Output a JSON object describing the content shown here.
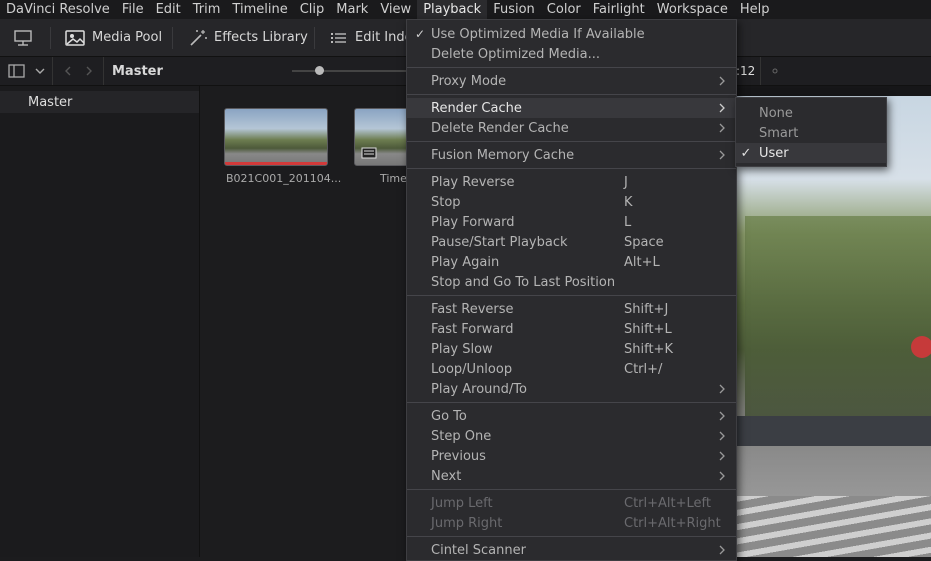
{
  "menubar": {
    "items": [
      "DaVinci Resolve",
      "File",
      "Edit",
      "Trim",
      "Timeline",
      "Clip",
      "Mark",
      "View",
      "Playback",
      "Fusion",
      "Color",
      "Fairlight",
      "Workspace",
      "Help"
    ],
    "active_index": 8
  },
  "toolbar": {
    "media_pool": "Media Pool",
    "effects_library": "Effects Library",
    "edit_index": "Edit Inde"
  },
  "subbar": {
    "bin_title": "Master",
    "timecode_fragment": ":12"
  },
  "sidebar": {
    "items": [
      {
        "label": "Master"
      }
    ]
  },
  "media_pool": {
    "clips": [
      {
        "label": "B021C001_201104..."
      },
      {
        "label": "Time"
      }
    ]
  },
  "playback_menu": {
    "items": [
      {
        "label": "Use Optimized Media If Available",
        "shortcut": "",
        "checked": true,
        "submenu": false,
        "disabled": false
      },
      {
        "label": "Delete Optimized Media...",
        "shortcut": "",
        "checked": false,
        "submenu": false,
        "disabled": false
      },
      {
        "label": "Proxy Mode",
        "shortcut": "",
        "checked": false,
        "submenu": true,
        "disabled": false
      },
      {
        "label": "Render Cache",
        "shortcut": "",
        "checked": false,
        "submenu": true,
        "disabled": false,
        "highlighted": true
      },
      {
        "label": "Delete Render Cache",
        "shortcut": "",
        "checked": false,
        "submenu": true,
        "disabled": false
      },
      {
        "label": "Fusion Memory Cache",
        "shortcut": "",
        "checked": false,
        "submenu": true,
        "disabled": false
      },
      {
        "label": "Play Reverse",
        "shortcut": "J",
        "checked": false,
        "submenu": false,
        "disabled": false
      },
      {
        "label": "Stop",
        "shortcut": "K",
        "checked": false,
        "submenu": false,
        "disabled": false
      },
      {
        "label": "Play Forward",
        "shortcut": "L",
        "checked": false,
        "submenu": false,
        "disabled": false
      },
      {
        "label": "Pause/Start Playback",
        "shortcut": "Space",
        "checked": false,
        "submenu": false,
        "disabled": false
      },
      {
        "label": "Play Again",
        "shortcut": "Alt+L",
        "checked": false,
        "submenu": false,
        "disabled": false
      },
      {
        "label": "Stop and Go To Last Position",
        "shortcut": "",
        "checked": false,
        "submenu": false,
        "disabled": false
      },
      {
        "label": "Fast Reverse",
        "shortcut": "Shift+J",
        "checked": false,
        "submenu": false,
        "disabled": false
      },
      {
        "label": "Fast Forward",
        "shortcut": "Shift+L",
        "checked": false,
        "submenu": false,
        "disabled": false
      },
      {
        "label": "Play Slow",
        "shortcut": "Shift+K",
        "checked": false,
        "submenu": false,
        "disabled": false
      },
      {
        "label": "Loop/Unloop",
        "shortcut": "Ctrl+/",
        "checked": false,
        "submenu": false,
        "disabled": false
      },
      {
        "label": "Play Around/To",
        "shortcut": "",
        "checked": false,
        "submenu": true,
        "disabled": false
      },
      {
        "label": "Go To",
        "shortcut": "",
        "checked": false,
        "submenu": true,
        "disabled": false
      },
      {
        "label": "Step One",
        "shortcut": "",
        "checked": false,
        "submenu": true,
        "disabled": false
      },
      {
        "label": "Previous",
        "shortcut": "",
        "checked": false,
        "submenu": true,
        "disabled": false
      },
      {
        "label": "Next",
        "shortcut": "",
        "checked": false,
        "submenu": true,
        "disabled": false
      },
      {
        "label": "Jump Left",
        "shortcut": "Ctrl+Alt+Left",
        "checked": false,
        "submenu": false,
        "disabled": true
      },
      {
        "label": "Jump Right",
        "shortcut": "Ctrl+Alt+Right",
        "checked": false,
        "submenu": false,
        "disabled": true
      },
      {
        "label": "Cintel Scanner",
        "shortcut": "",
        "checked": false,
        "submenu": true,
        "disabled": false
      }
    ]
  },
  "render_cache_submenu": {
    "items": [
      {
        "label": "None",
        "checked": false
      },
      {
        "label": "Smart",
        "checked": false
      },
      {
        "label": "User",
        "checked": true
      }
    ]
  },
  "colors": {
    "accent_red": "#d23a3a",
    "menu_bg": "#2b2b2e",
    "highlight_bg": "#38383c"
  }
}
